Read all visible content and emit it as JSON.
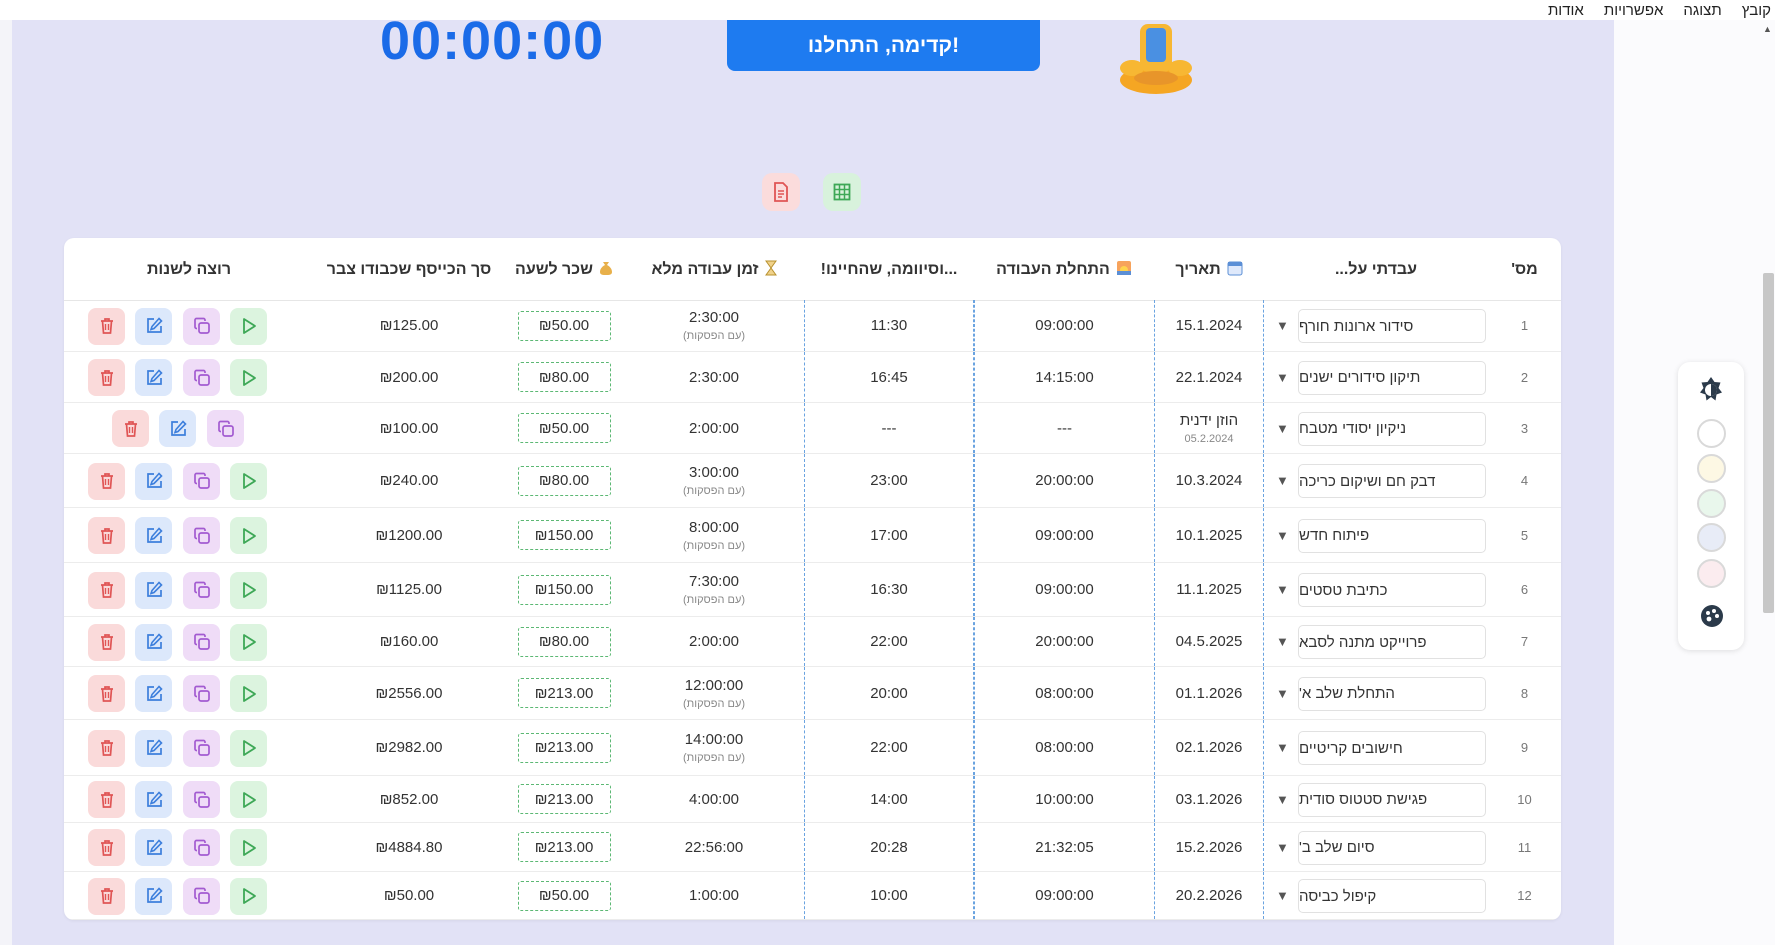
{
  "menu": [
    "קובץ",
    "תצוגה",
    "אפשרויות",
    "אודות"
  ],
  "timer": "00:00:00",
  "start_button": "קדימה, התחלנו!",
  "headers": {
    "num": "מס'",
    "task": "עבדתי על...",
    "date": "תאריך",
    "start": "התחלת העבודה",
    "end": "...וסיוומה, שהחיינו!",
    "duration": "זמן עבודה מלא",
    "rate": "שכר לשעה",
    "total": "סך הכייסף שכבודו צבר",
    "actions": "רוצה לשנות"
  },
  "header_icons": {
    "date": "calendar-icon",
    "start": "sunrise-icon",
    "duration": "hourglass-icon",
    "rate": "money-bag-icon"
  },
  "rows": [
    {
      "num": "1",
      "task": "סידור ארונות חורף",
      "date": "15.1.2024",
      "date_sub": "",
      "start": "09:00:00",
      "end": "11:30",
      "duration": "2:30:00",
      "duration_sub": "(עם הפסקות)",
      "rate": "₪50.00",
      "total": "₪125.00",
      "play": true
    },
    {
      "num": "2",
      "task": "תיקון סידורים ישנים",
      "date": "22.1.2024",
      "date_sub": "",
      "start": "14:15:00",
      "end": "16:45",
      "duration": "2:30:00",
      "duration_sub": "",
      "rate": "₪80.00",
      "total": "₪200.00",
      "play": true
    },
    {
      "num": "3",
      "task": "ניקיון יסודי מטבח",
      "date": "הוזן ידנית",
      "date_sub": "05.2.2024",
      "start": "---",
      "end": "---",
      "duration": "2:00:00",
      "duration_sub": "",
      "rate": "₪50.00",
      "total": "₪100.00",
      "play": false
    },
    {
      "num": "4",
      "task": "דבק חם ושיקום כריכה",
      "date": "10.3.2024",
      "date_sub": "",
      "start": "20:00:00",
      "end": "23:00",
      "duration": "3:00:00",
      "duration_sub": "(עם הפסקות)",
      "rate": "₪80.00",
      "total": "₪240.00",
      "play": true
    },
    {
      "num": "5",
      "task": "פיתוח חדש",
      "date": "10.1.2025",
      "date_sub": "",
      "start": "09:00:00",
      "end": "17:00",
      "duration": "8:00:00",
      "duration_sub": "(עם הפסקות)",
      "rate": "₪150.00",
      "total": "₪1200.00",
      "play": true
    },
    {
      "num": "6",
      "task": "כתיבת טסטים",
      "date": "11.1.2025",
      "date_sub": "",
      "start": "09:00:00",
      "end": "16:30",
      "duration": "7:30:00",
      "duration_sub": "(עם הפסקות)",
      "rate": "₪150.00",
      "total": "₪1125.00",
      "play": true
    },
    {
      "num": "7",
      "task": "פרוייקט מתנה לסבא",
      "date": "04.5.2025",
      "date_sub": "",
      "start": "20:00:00",
      "end": "22:00",
      "duration": "2:00:00",
      "duration_sub": "",
      "rate": "₪80.00",
      "total": "₪160.00",
      "play": true
    },
    {
      "num": "8",
      "task": "התחלת שלב א'",
      "date": "01.1.2026",
      "date_sub": "",
      "start": "08:00:00",
      "end": "20:00",
      "duration": "12:00:00",
      "duration_sub": "(עם הפסקות)",
      "rate": "₪213.00",
      "total": "₪2556.00",
      "play": true
    },
    {
      "num": "9",
      "task": "חישובים קריטיים",
      "date": "02.1.2026",
      "date_sub": "",
      "start": "08:00:00",
      "end": "22:00",
      "duration": "14:00:00",
      "duration_sub": "(עם הפסקות)",
      "rate": "₪213.00",
      "total": "₪2982.00",
      "play": true
    },
    {
      "num": "10",
      "task": "פגישת סטטוס סודית",
      "date": "03.1.2026",
      "date_sub": "",
      "start": "10:00:00",
      "end": "14:00",
      "duration": "4:00:00",
      "duration_sub": "",
      "rate": "₪213.00",
      "total": "₪852.00",
      "play": true
    },
    {
      "num": "11",
      "task": "סיום שלב ב'",
      "date": "15.2.2026",
      "date_sub": "",
      "start": "21:32:05",
      "end": "20:28",
      "duration": "22:56:00",
      "duration_sub": "",
      "rate": "₪213.00",
      "total": "₪4884.80",
      "play": true
    },
    {
      "num": "12",
      "task": "קיפול כביסה",
      "date": "20.2.2026",
      "date_sub": "",
      "start": "09:00:00",
      "end": "10:00",
      "duration": "1:00:00",
      "duration_sub": "",
      "rate": "₪50.00",
      "total": "₪50.00",
      "play": true
    }
  ],
  "theme_swatches": [
    "#ffffff",
    "#fdf8e4",
    "#e9f7ec",
    "#e8ecf7",
    "#fbecef"
  ],
  "colors": {
    "accent": "#1e7bf0",
    "timer": "#1a6be8",
    "background": "#e2e2f6",
    "delete": "#e05555",
    "edit": "#3d7fdc",
    "copy": "#a35bd1",
    "play": "#3ea857"
  }
}
